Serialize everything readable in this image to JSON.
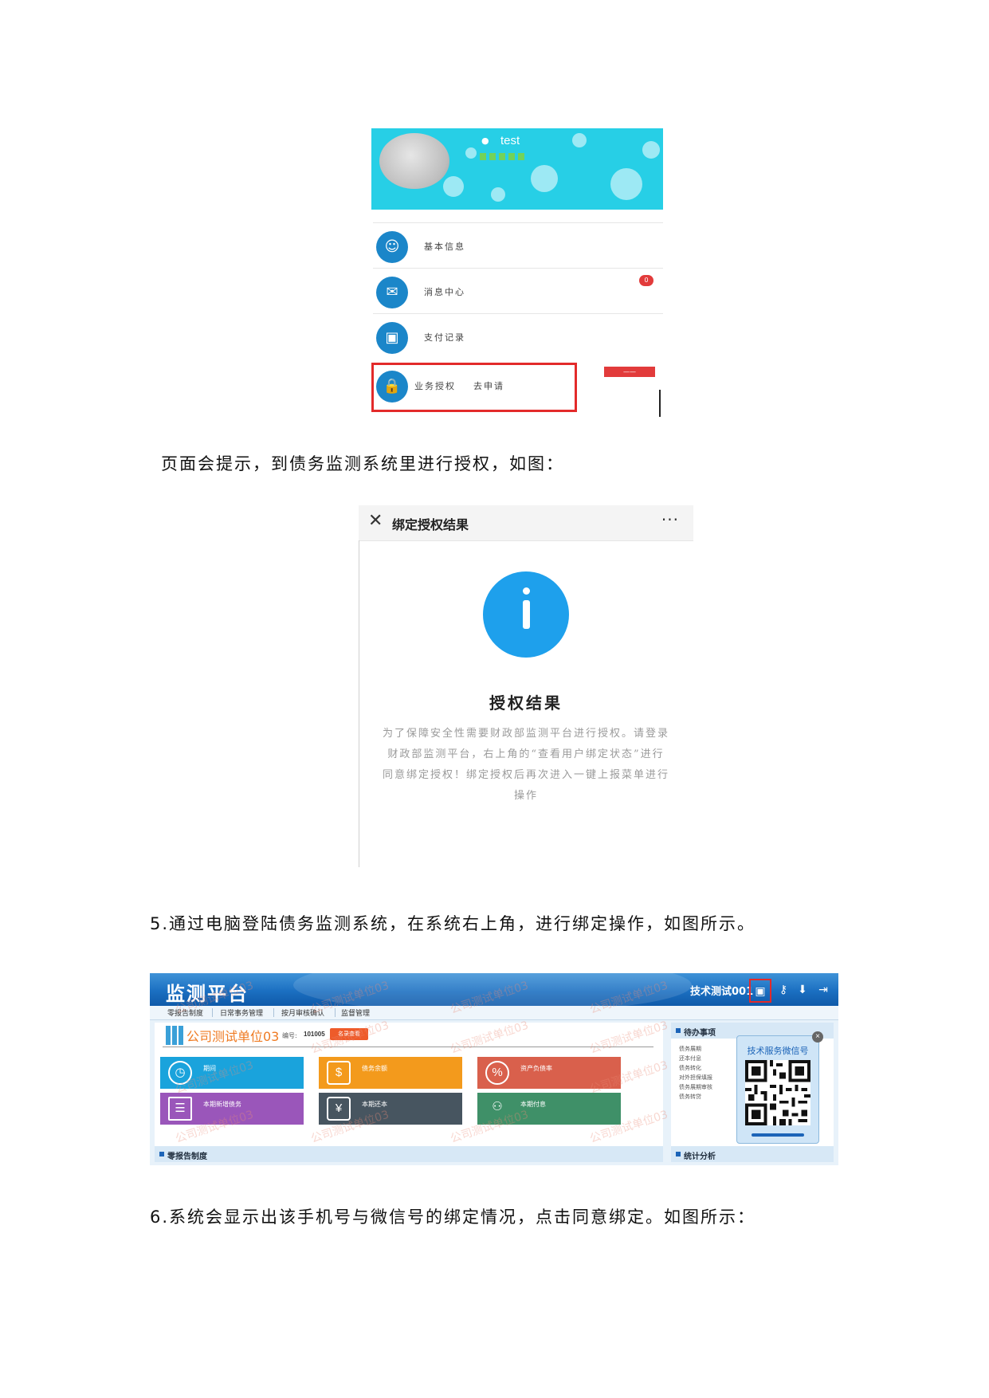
{
  "figure1": {
    "username": "test",
    "menu": [
      {
        "label": "基本信息",
        "icon": "user-icon"
      },
      {
        "label": "消息中心",
        "icon": "mail-icon"
      },
      {
        "label": "支付记录",
        "icon": "money-icon"
      },
      {
        "label": "业务授权    去申请",
        "icon": "lock-icon"
      }
    ],
    "highlight_color": "#e32a2a",
    "accent_color": "#1b86c9"
  },
  "paragraph1": "页面会提示，到债务监测系统里进行授权，如图：",
  "figure2": {
    "title": "绑定授权结果",
    "more": "···",
    "result_title": "授权结果",
    "result_body": "为了保障安全性需要财政部监测平台进行授权。请登录财政部监测平台，右上角的“查看用户绑定状态”进行同意绑定授权！绑定授权后再次进入一键上报菜单进行操作",
    "icon_color": "#1ea0ec"
  },
  "paragraph2": "5.通过电脑登陆债务监测系统，在系统右上角，进行绑定操作，如图所示。",
  "figure3": {
    "brand": "监测平台",
    "user": "技术测试001",
    "nav": [
      "零报告制度",
      "日常事务管理",
      "按月审核确认",
      "监督管理"
    ],
    "unit_name": "公司测试单位03",
    "number_label": "编号:",
    "number": "101005",
    "red_button": "名录查看",
    "tiles": [
      {
        "label": "期间",
        "color": "#1aa3dc",
        "icon": "clock-icon"
      },
      {
        "label": "债务余额",
        "color": "#f39a1c",
        "icon": "balance-icon"
      },
      {
        "label": "资产负债率",
        "color": "#d9604c",
        "icon": "percent-icon"
      },
      {
        "label": "本期新增债务",
        "color": "#9a56ba",
        "icon": "clipboard-icon"
      },
      {
        "label": "本期还本",
        "color": "#475560",
        "icon": "yuan-icon"
      },
      {
        "label": "本期付息",
        "color": "#3f9068",
        "icon": "coin-hand-icon"
      }
    ],
    "todo_title": "待办事项",
    "todo_items": [
      "债务展期",
      "还本付息",
      "债务转化",
      "对外担保填报",
      "债务展期审核",
      "债务转贷"
    ],
    "qr_title": "技术服务微信号",
    "section_left": "零报告制度",
    "section_right": "统计分析",
    "watermark": "公司测试单位03"
  },
  "paragraph3": "6.系统会显示出该手机号与微信号的绑定情况，点击同意绑定。如图所示："
}
